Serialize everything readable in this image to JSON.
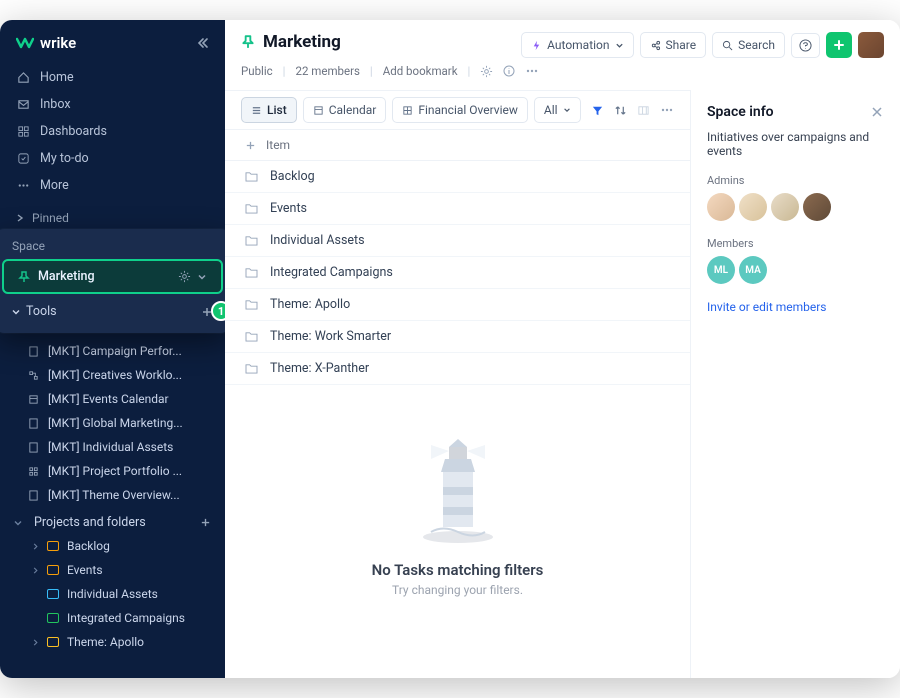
{
  "brand": {
    "name": "wrike"
  },
  "nav": {
    "items": [
      {
        "label": "Home",
        "icon": "home-icon"
      },
      {
        "label": "Inbox",
        "icon": "inbox-icon"
      },
      {
        "label": "Dashboards",
        "icon": "dashboard-icon"
      },
      {
        "label": "My to-do",
        "icon": "todo-icon"
      },
      {
        "label": "More",
        "icon": "more-icon"
      }
    ]
  },
  "pinned_label": "Pinned",
  "space_popout": {
    "label": "Space",
    "active": {
      "name": "Marketing"
    },
    "tools_label": "Tools",
    "badge": "1"
  },
  "mkt_items": [
    "[MKT] Campaign Perfor...",
    "[MKT] Creatives Worklo...",
    "[MKT] Events Calendar",
    "[MKT] Global Marketing...",
    "[MKT] Individual Assets",
    "[MKT] Project Portfolio ...",
    "[MKT] Theme Overview..."
  ],
  "projects_label": "Projects and folders",
  "folders": [
    {
      "name": "Backlog",
      "color": "orange",
      "expandable": true
    },
    {
      "name": "Events",
      "color": "orange",
      "expandable": true
    },
    {
      "name": "Individual Assets",
      "color": "blue",
      "expandable": false
    },
    {
      "name": "Integrated Campaigns",
      "color": "green",
      "expandable": false
    },
    {
      "name": "Theme: Apollo",
      "color": "yellow",
      "expandable": true
    }
  ],
  "header": {
    "title": "Marketing",
    "visibility": "Public",
    "members": "22 members",
    "bookmark": "Add bookmark"
  },
  "actions": {
    "automation": "Automation",
    "share": "Share",
    "search": "Search"
  },
  "tabs": [
    {
      "label": "List",
      "icon": "list-icon",
      "active": true
    },
    {
      "label": "Calendar",
      "icon": "calendar-icon",
      "active": false
    },
    {
      "label": "Financial Overview",
      "icon": "table-icon",
      "active": false
    },
    {
      "label": "All",
      "icon": "",
      "active": false
    }
  ],
  "list": {
    "header": "Item",
    "rows": [
      "Backlog",
      "Events",
      "Individual Assets",
      "Integrated Campaigns",
      "Theme: Apollo",
      "Theme: Work Smarter",
      "Theme: X-Panther"
    ]
  },
  "empty": {
    "title": "No Tasks matching filters",
    "sub": "Try changing your filters."
  },
  "panel": {
    "title": "Space info",
    "desc": "Initiatives over campaigns and events",
    "admins_label": "Admins",
    "members_label": "Members",
    "member_initials": [
      "ML",
      "MA"
    ],
    "invite": "Invite or edit members"
  }
}
